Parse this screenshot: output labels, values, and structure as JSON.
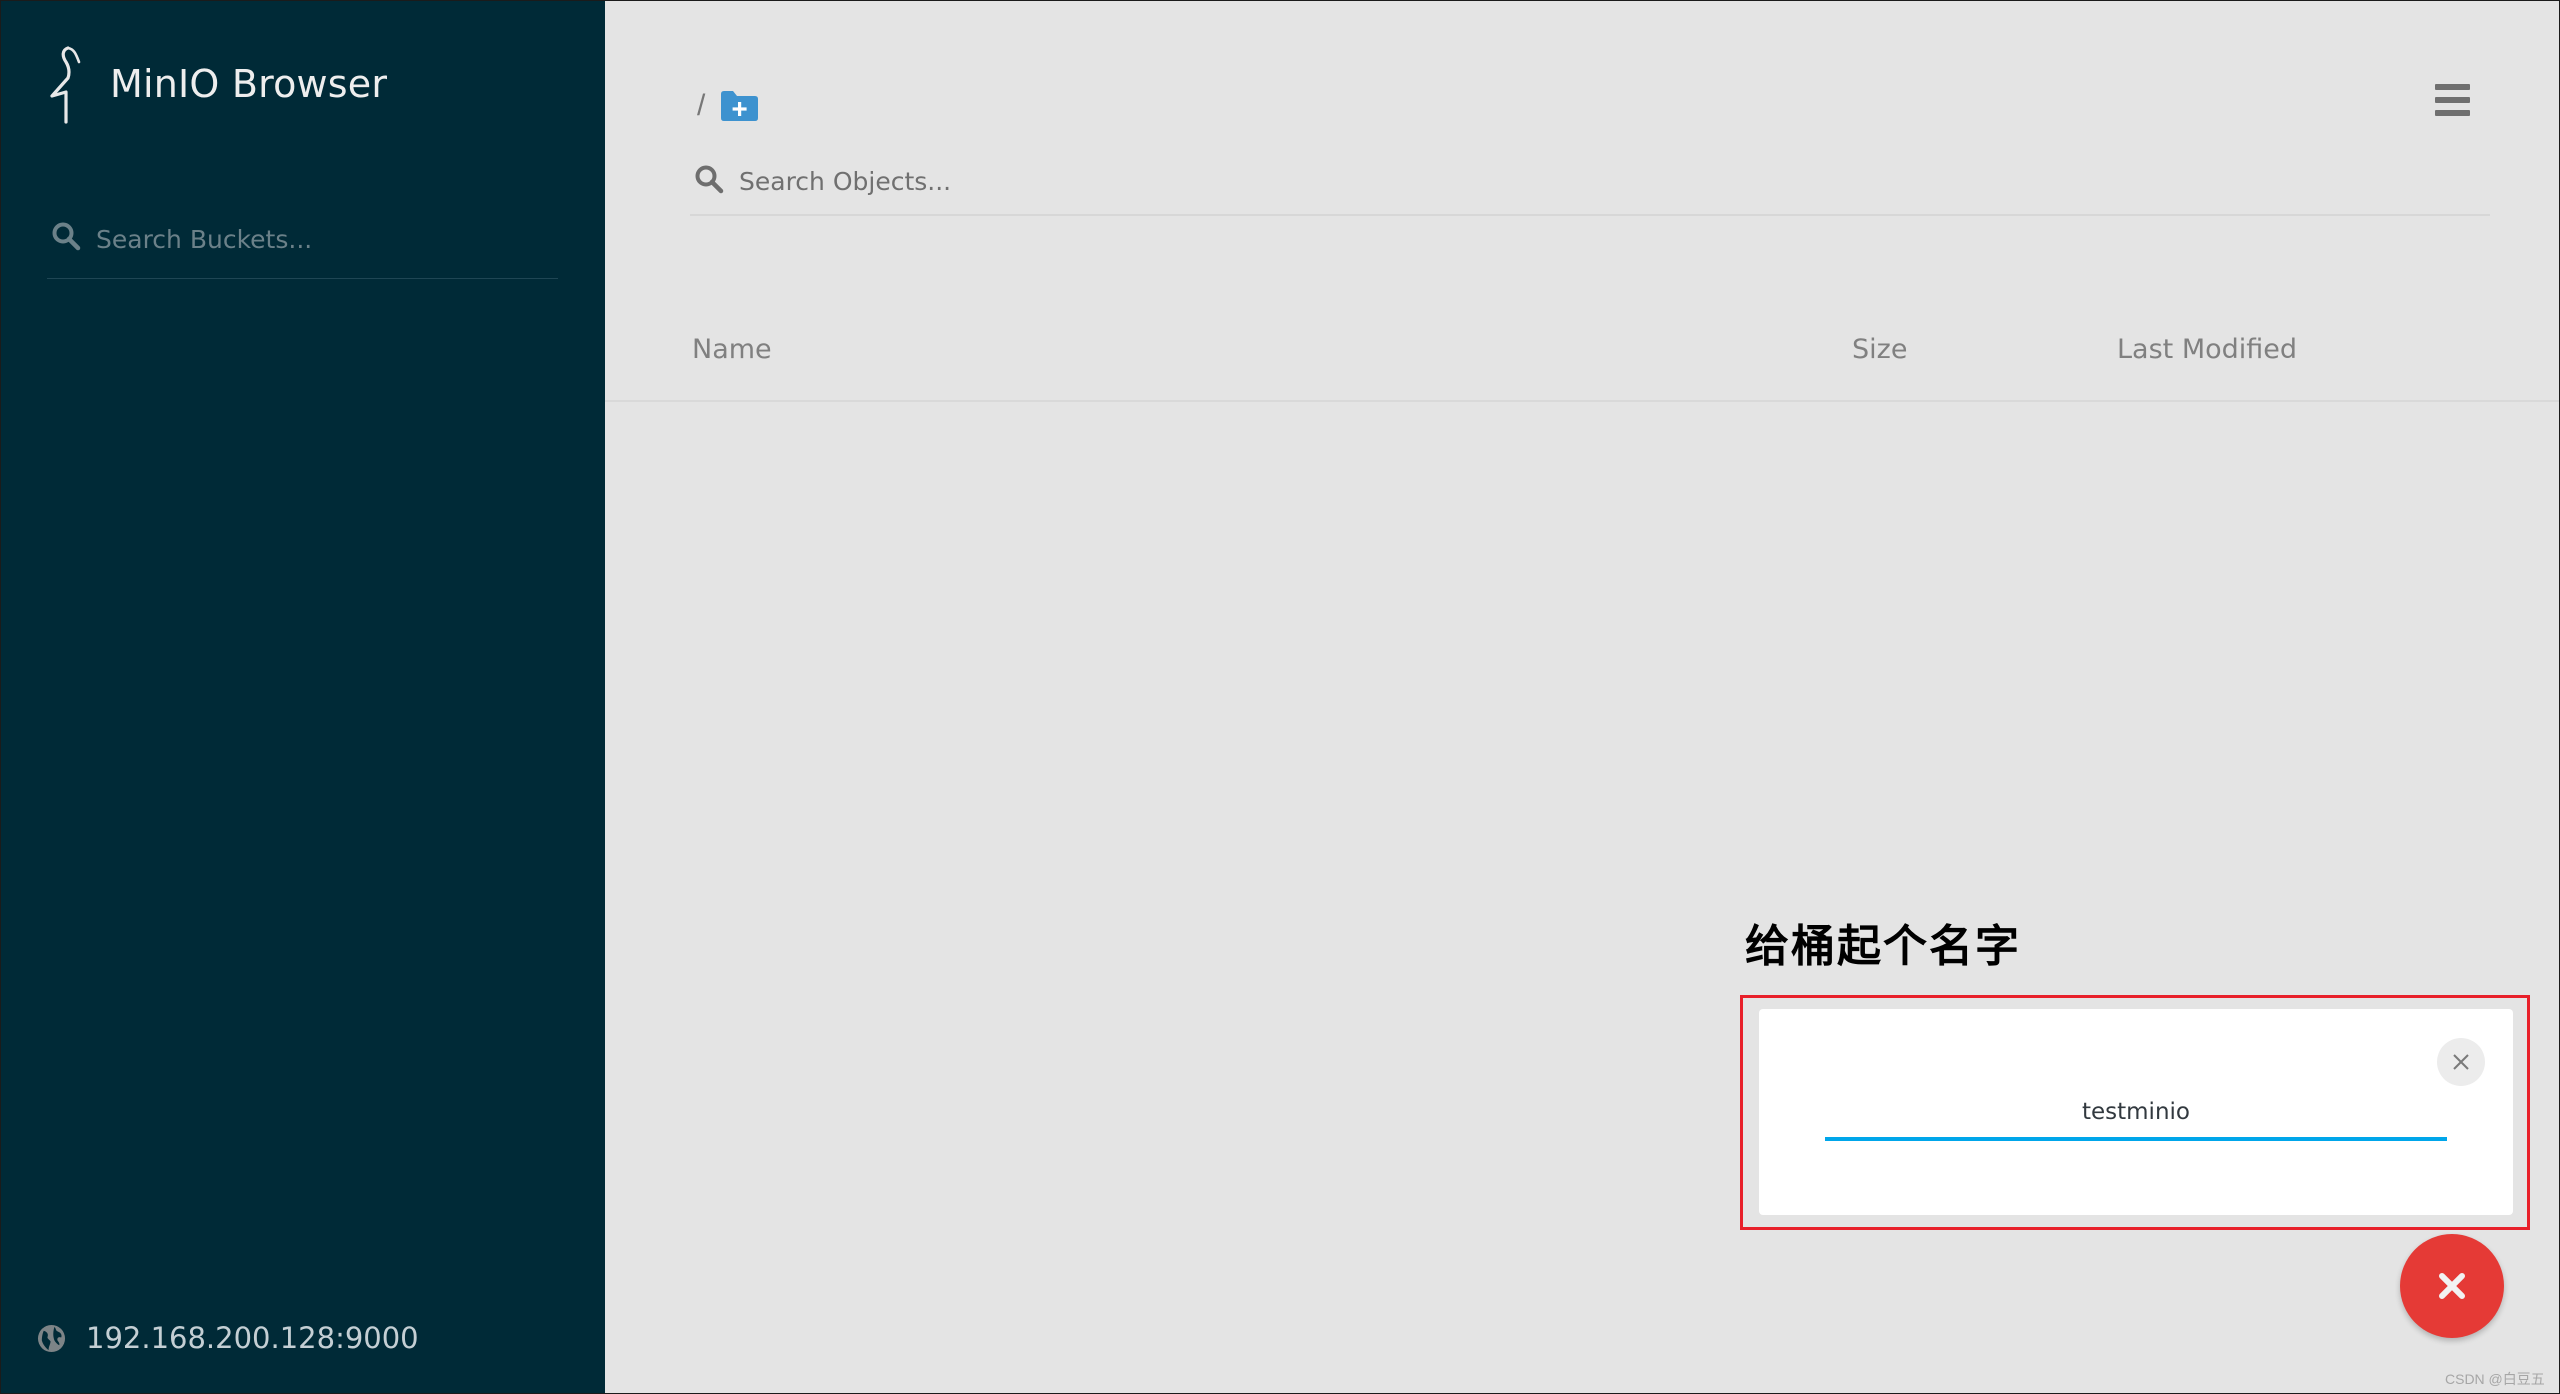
{
  "app": {
    "title": "MinIO Browser"
  },
  "sidebar": {
    "search": {
      "placeholder": "Search Buckets...",
      "value": ""
    },
    "host": "192.168.200.128:9000"
  },
  "main": {
    "breadcrumb": {
      "separator": "/"
    },
    "object_search": {
      "placeholder": "Search Objects...",
      "value": ""
    },
    "table": {
      "columns": [
        {
          "label": "Name"
        },
        {
          "label": "Size"
        },
        {
          "label": "Last Modified"
        }
      ],
      "rows": []
    }
  },
  "create_bucket": {
    "bucket_name_value": "testminio",
    "close_icon": "close-icon"
  },
  "annotation": {
    "text": "给桶起个名字",
    "highlight_color": "#e8202a"
  },
  "fab": {
    "icon": "close-icon",
    "color": "#e53a36"
  },
  "colors": {
    "sidebar_bg": "#002a37",
    "main_bg": "#e4e4e4",
    "accent_blue": "#00a6ea",
    "folder_icon": "#3d92cf"
  },
  "watermark": "CSDN @白豆五"
}
